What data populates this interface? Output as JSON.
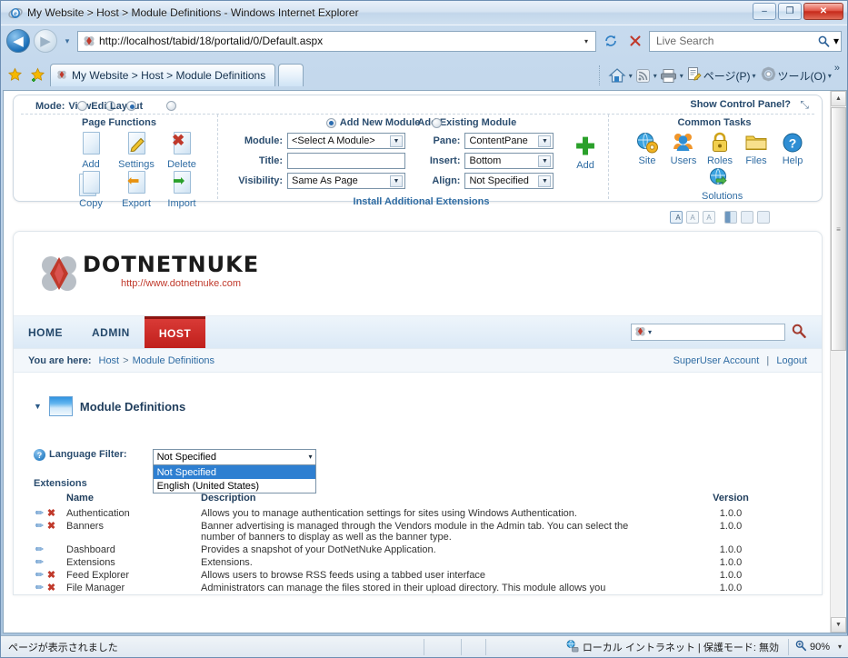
{
  "window": {
    "title": "My Website > Host > Module Definitions - Windows Internet Explorer",
    "minimize_label": "–",
    "maximize_label": "❐",
    "close_label": "✕"
  },
  "browser": {
    "back_label": "◀",
    "forward_label": "▶",
    "history_caret": "▾",
    "url": "http://localhost/tabid/18/portalid/0/Default.aspx",
    "url_dropdown_caret": "▾",
    "refresh_label": "↺",
    "stop_label": "✕",
    "search_placeholder": "Live Search",
    "search_caret": "▾",
    "tab_title": "My Website > Host > Module Definitions",
    "toolbar": {
      "home_caret": "▾",
      "feeds_caret": "▾",
      "print_caret": "▾",
      "page_label": "ページ(P)",
      "page_caret": "▾",
      "tools_label": "ツール(O)",
      "tools_caret": "▾",
      "overflow": "»"
    }
  },
  "control_panel": {
    "mode_label": "Mode:",
    "mode_options": [
      {
        "label": "View",
        "selected": false
      },
      {
        "label": "Edit",
        "selected": false
      },
      {
        "label": "Layout",
        "selected": true
      }
    ],
    "show_control_panel": "Show Control Panel?",
    "pin_icon": "⤡",
    "page_functions": {
      "title": "Page Functions",
      "items": [
        {
          "label": "Add",
          "icon": "blank-page-icon"
        },
        {
          "label": "Settings",
          "icon": "pencil-page-icon"
        },
        {
          "label": "Delete",
          "icon": "delete-page-icon"
        },
        {
          "label": "Copy",
          "icon": "copy-page-icon"
        },
        {
          "label": "Export",
          "icon": "export-page-icon"
        },
        {
          "label": "Import",
          "icon": "import-page-icon"
        }
      ]
    },
    "module_form": {
      "add_new_label": "Add New Module",
      "add_existing_label": "Add Existing Module",
      "add_new_selected": true,
      "module_label": "Module:",
      "module_value": "<Select A Module>",
      "title_label": "Title:",
      "title_value": "",
      "visibility_label": "Visibility:",
      "visibility_value": "Same As Page",
      "pane_label": "Pane:",
      "pane_value": "ContentPane",
      "insert_label": "Insert:",
      "insert_value": "Bottom",
      "align_label": "Align:",
      "align_value": "Not Specified",
      "add_button_label": "Add",
      "add_button_icon": "green-plus-icon",
      "install_link": "Install Additional Extensions"
    },
    "common_tasks": {
      "title": "Common Tasks",
      "items": [
        {
          "label": "Site",
          "icon": "globe-gear-icon"
        },
        {
          "label": "Users",
          "icon": "users-icon"
        },
        {
          "label": "Roles",
          "icon": "padlock-icon"
        },
        {
          "label": "Files",
          "icon": "folder-icon"
        },
        {
          "label": "Help",
          "icon": "question-icon"
        },
        {
          "label": "Solutions",
          "icon": "globe-arrow-icon"
        }
      ]
    }
  },
  "skin_toolbar": {
    "font_buttons": [
      "A",
      "A",
      "A"
    ],
    "layout_buttons": [
      "pane-split",
      "pane-light",
      "pane-blank"
    ]
  },
  "site": {
    "logo_text": "DOTNETNUKE",
    "logo_url": "http://www.dotnetnuke.com",
    "nav": [
      {
        "label": "HOME",
        "active": false
      },
      {
        "label": "ADMIN",
        "active": false
      },
      {
        "label": "HOST",
        "active": true
      }
    ],
    "search_value": "",
    "search_icon": "magnifier-icon",
    "search_dropdown_caret": "▾",
    "breadcrumb_label": "You are here:",
    "breadcrumb": [
      "Host",
      "Module Definitions"
    ],
    "breadcrumb_sep": ">",
    "account_link": "SuperUser Account",
    "account_sep": "|",
    "logout_link": "Logout"
  },
  "module": {
    "collapse_caret": "▼",
    "title": "Module Definitions",
    "language_filter_label": "Language Filter:",
    "language_filter_value": "Not Specified",
    "language_filter_caret": "▾",
    "language_filter_options": [
      {
        "label": "Not Specified",
        "highlighted": true
      },
      {
        "label": "English (United States)",
        "highlighted": false
      }
    ],
    "extensions_label": "Extensions",
    "columns": [
      "Name",
      "Description",
      "Version"
    ],
    "rows": [
      {
        "edit_icon": "pencil-icon",
        "delete_icon": "red-x-icon",
        "has_delete": true,
        "name": "Authentication",
        "description": "Allows you to manage authentication settings for sites using Windows Authentication.",
        "version": "1.0.0"
      },
      {
        "edit_icon": "pencil-icon",
        "delete_icon": "red-x-icon",
        "has_delete": true,
        "name": "Banners",
        "description": "Banner advertising is managed through the Vendors module in the Admin tab. You can select the number of banners to display as well as the banner type.",
        "version": "1.0.0"
      },
      {
        "edit_icon": "pencil-icon",
        "delete_icon": "",
        "has_delete": false,
        "name": "Dashboard",
        "description": "Provides a snapshot of your DotNetNuke Application.",
        "version": "1.0.0"
      },
      {
        "edit_icon": "pencil-icon",
        "delete_icon": "",
        "has_delete": false,
        "name": "Extensions",
        "description": "Extensions.",
        "version": "1.0.0"
      },
      {
        "edit_icon": "pencil-icon",
        "delete_icon": "red-x-icon",
        "has_delete": true,
        "name": "Feed Explorer",
        "description": "Allows users to browse RSS feeds using a tabbed user interface",
        "version": "1.0.0"
      },
      {
        "edit_icon": "pencil-icon",
        "delete_icon": "red-x-icon",
        "has_delete": true,
        "name": "File Manager",
        "description": "Administrators can manage the files stored in their upload directory. This module allows you",
        "version": "1.0.0"
      }
    ]
  },
  "scrollbar": {
    "up": "▲",
    "down": "▼",
    "grip": "≡"
  },
  "status": {
    "message": "ページが表示されました",
    "zone_icon": "network-icon",
    "zone": "ローカル イントラネット | 保護モード: 無効",
    "zoom_icon": "zoom-icon",
    "zoom": "90%",
    "zoom_caret": "▾"
  },
  "colors": {
    "accent_red": "#c0201c",
    "link_blue": "#2f6ca3",
    "highlight_blue": "#2e7fd1"
  }
}
